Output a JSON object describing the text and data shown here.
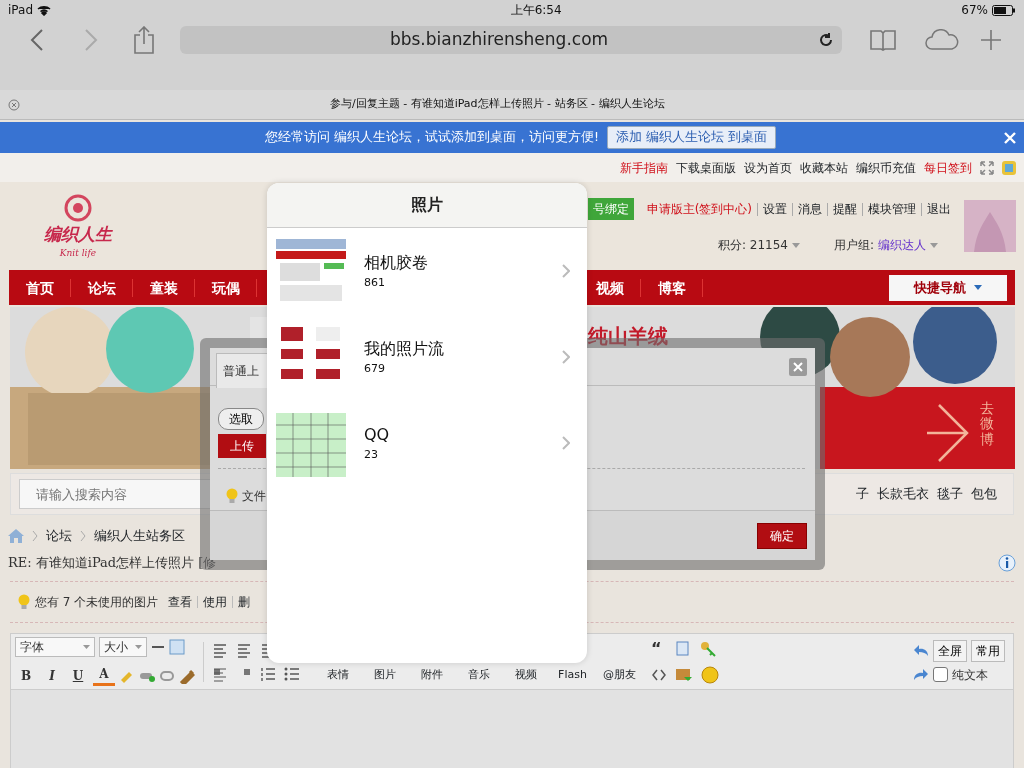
{
  "status_bar": {
    "carrier": "iPad",
    "time": "上午6:54",
    "battery": "67%"
  },
  "browser": {
    "url": "bbs.bianzhirensheng.com",
    "tab_title": "参与/回复主题 - 有谁知道iPad怎样上传照片 - 站务区 - 编织人生论坛"
  },
  "notice_bar": {
    "text": "您经常访问 编织人生论坛，试试添加到桌面，访问更方便!",
    "button": "添加 编织人生论坛 到桌面"
  },
  "top_links": [
    {
      "label": "新手指南",
      "highlight": true
    },
    {
      "label": "下载桌面版",
      "highlight": false
    },
    {
      "label": "设为首页",
      "highlight": false
    },
    {
      "label": "收藏本站",
      "highlight": false
    },
    {
      "label": "编织币充值",
      "highlight": false
    },
    {
      "label": "每日签到",
      "highlight": true
    }
  ],
  "header": {
    "logo_text": "编织人生",
    "logo_tagline": "Knit life"
  },
  "user_bar": {
    "bind_badge": "号绑定",
    "links": [
      {
        "label": "申请版主(签到中心)",
        "highlight": true
      },
      {
        "label": "设置",
        "highlight": false
      },
      {
        "label": "消息",
        "highlight": false
      },
      {
        "label": "提醒",
        "highlight": false
      },
      {
        "label": "模块管理",
        "highlight": false
      },
      {
        "label": "退出",
        "highlight": false
      }
    ],
    "points": "积分: 21154",
    "group_label": "用户组:",
    "group": "编织达人"
  },
  "nav": {
    "items_left": [
      "首页",
      "论坛",
      "童装",
      "玩偶"
    ],
    "items_right": [
      "视频",
      "博客"
    ],
    "quick_nav": "快捷导航"
  },
  "banner": {
    "headline": "纯山羊绒",
    "side_link": "去微博"
  },
  "search": {
    "placeholder": "请输入搜索内容",
    "hot_words": [
      "子",
      "长款毛衣",
      "毯子",
      "包包"
    ]
  },
  "breadcrumb": [
    "论坛",
    "编织人生站务区"
  ],
  "post_title": "RE: 有谁知道iPad怎样上传照片 [修",
  "image_notice": {
    "text": "您有 7 个未使用的图片",
    "links": [
      "查看",
      "使用",
      "删"
    ]
  },
  "editor": {
    "font_select": "字体",
    "size_select": "大小",
    "format_buttons": [
      "B",
      "I",
      "U",
      "A"
    ],
    "insert_tools": [
      "表情",
      "图片",
      "附件",
      "音乐",
      "视频",
      "Flash",
      "@朋友"
    ],
    "quote": "“",
    "buttons": [
      "全屏",
      "常用"
    ],
    "plain_text": {
      "label": "纯文本",
      "checked": false
    }
  },
  "upload_dialog": {
    "tab": "普通上",
    "select_button": "选取",
    "upload_button": "上传",
    "hint": "文件",
    "ok_button": "确定"
  },
  "photos_popover": {
    "title": "照片",
    "albums": [
      {
        "name": "相机胶卷",
        "count": "861",
        "kind": "screen"
      },
      {
        "name": "我的照片流",
        "count": "679",
        "kind": "garments"
      },
      {
        "name": "QQ",
        "count": "23",
        "kind": "table"
      }
    ]
  }
}
